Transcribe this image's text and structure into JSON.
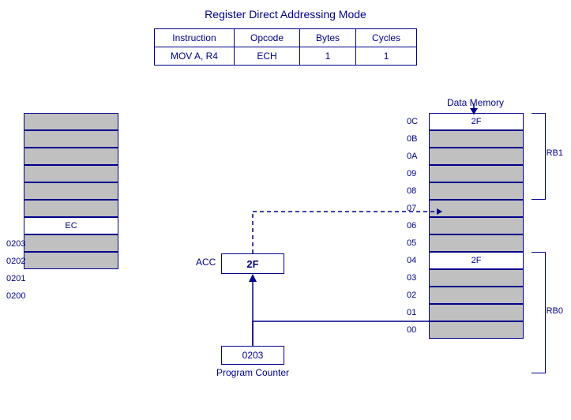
{
  "title": "Register Direct Addressing Mode",
  "table": {
    "headers": [
      "Instruction",
      "Opcode",
      "Bytes",
      "Cycles"
    ],
    "row": [
      "MOV A, R4",
      "ECH",
      "1",
      "1"
    ]
  },
  "prog_mem": {
    "cells": [
      "",
      "",
      "",
      "",
      "",
      "EC",
      "",
      ""
    ],
    "addresses": [
      "0203",
      "0202",
      "0201",
      "0200"
    ]
  },
  "acc": {
    "label": "ACC",
    "value": "2F"
  },
  "pc": {
    "value": "0203",
    "label": "Program Counter"
  },
  "data_mem": {
    "title": "Data Memory",
    "cells": [
      {
        "addr": "0C",
        "value": "2F",
        "white": true
      },
      {
        "addr": "0B",
        "value": "",
        "white": false
      },
      {
        "addr": "0A",
        "value": "",
        "white": false
      },
      {
        "addr": "09",
        "value": "",
        "white": false
      },
      {
        "addr": "08",
        "value": "",
        "white": false
      },
      {
        "addr": "07",
        "value": "",
        "white": false
      },
      {
        "addr": "06",
        "value": "",
        "white": false
      },
      {
        "addr": "05",
        "value": "",
        "white": false
      },
      {
        "addr": "04",
        "value": "2F",
        "white": true
      },
      {
        "addr": "03",
        "value": "",
        "white": false
      },
      {
        "addr": "02",
        "value": "",
        "white": false
      },
      {
        "addr": "01",
        "value": "",
        "white": false
      },
      {
        "addr": "00",
        "value": "",
        "white": false
      }
    ],
    "rb1_label": "RB1",
    "rb0_label": "RB0"
  }
}
